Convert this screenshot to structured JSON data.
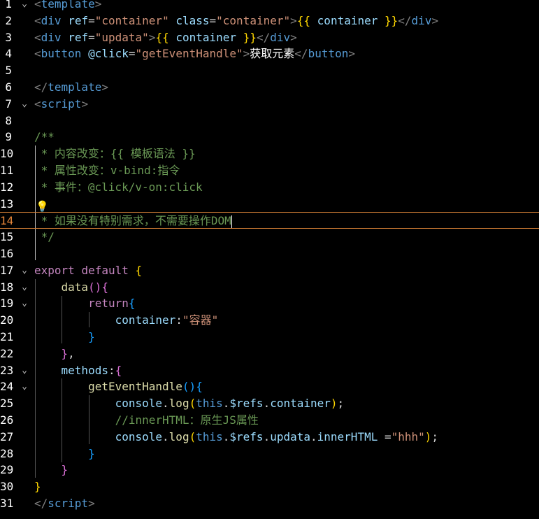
{
  "editor": {
    "current_line": 14,
    "lines": [
      {
        "n": "1",
        "fold": true,
        "tokens": [
          [
            "tag",
            "<"
          ],
          [
            "tn",
            "template"
          ],
          [
            "tag",
            ">"
          ]
        ]
      },
      {
        "n": "2",
        "fold": false,
        "tokens": [
          [
            "tag",
            "<"
          ],
          [
            "tn",
            "div"
          ],
          [
            "op",
            " "
          ],
          [
            "attr",
            "ref"
          ],
          [
            "op",
            "="
          ],
          [
            "str",
            "\"container\""
          ],
          [
            "op",
            " "
          ],
          [
            "attr",
            "class"
          ],
          [
            "op",
            "="
          ],
          [
            "str",
            "\"container\""
          ],
          [
            "tag",
            ">"
          ],
          [
            "br",
            "{{"
          ],
          [
            "op",
            " "
          ],
          [
            "var",
            "container"
          ],
          [
            "op",
            " "
          ],
          [
            "br",
            "}}"
          ],
          [
            "tag",
            "</"
          ],
          [
            "tn",
            "div"
          ],
          [
            "tag",
            ">"
          ]
        ]
      },
      {
        "n": "3",
        "fold": false,
        "tokens": [
          [
            "tag",
            "<"
          ],
          [
            "tn",
            "div"
          ],
          [
            "op",
            " "
          ],
          [
            "attr",
            "ref"
          ],
          [
            "op",
            "="
          ],
          [
            "str",
            "\"updata\""
          ],
          [
            "tag",
            ">"
          ],
          [
            "br",
            "{{"
          ],
          [
            "op",
            " "
          ],
          [
            "var",
            "container"
          ],
          [
            "op",
            " "
          ],
          [
            "br",
            "}}"
          ],
          [
            "tag",
            "</"
          ],
          [
            "tn",
            "div"
          ],
          [
            "tag",
            ">"
          ]
        ]
      },
      {
        "n": "4",
        "fold": false,
        "tokens": [
          [
            "tag",
            "<"
          ],
          [
            "tn",
            "button"
          ],
          [
            "op",
            " "
          ],
          [
            "attr",
            "@click"
          ],
          [
            "op",
            "="
          ],
          [
            "str",
            "\"getEventHandle\""
          ],
          [
            "tag",
            ">"
          ],
          [
            "txt",
            "获取元素"
          ],
          [
            "tag",
            "</"
          ],
          [
            "tn",
            "button"
          ],
          [
            "tag",
            ">"
          ]
        ]
      },
      {
        "n": "5",
        "fold": false,
        "tokens": []
      },
      {
        "n": "6",
        "fold": false,
        "tokens": [
          [
            "tag",
            "</"
          ],
          [
            "tn",
            "template"
          ],
          [
            "tag",
            ">"
          ]
        ]
      },
      {
        "n": "7",
        "fold": true,
        "tokens": [
          [
            "tag",
            "<"
          ],
          [
            "tn",
            "script"
          ],
          [
            "tag",
            ">"
          ]
        ]
      },
      {
        "n": "8",
        "fold": false,
        "tokens": []
      },
      {
        "n": "9",
        "fold": false,
        "tokens": [
          [
            "cm",
            "/**"
          ]
        ]
      },
      {
        "n": "10",
        "fold": false,
        "tokens": [
          [
            "cm",
            " * 内容改变：{{ 模板语法 }}"
          ]
        ]
      },
      {
        "n": "11",
        "fold": false,
        "tokens": [
          [
            "cm",
            " * 属性改变：v-bind:指令"
          ]
        ]
      },
      {
        "n": "12",
        "fold": false,
        "tokens": [
          [
            "cm",
            " * 事件：@click/v-on:click"
          ]
        ]
      },
      {
        "n": "13",
        "fold": false,
        "tokens": []
      },
      {
        "n": "14",
        "fold": false,
        "tokens": [
          [
            "cm",
            " * 如果没有特别需求，不需要操作DOM"
          ]
        ]
      },
      {
        "n": "15",
        "fold": false,
        "tokens": [
          [
            "cm",
            " */"
          ]
        ]
      },
      {
        "n": "16",
        "fold": false,
        "tokens": []
      },
      {
        "n": "17",
        "fold": true,
        "tokens": [
          [
            "kw",
            "export"
          ],
          [
            "op",
            " "
          ],
          [
            "kw",
            "default"
          ],
          [
            "op",
            " "
          ],
          [
            "br",
            "{"
          ]
        ]
      },
      {
        "n": "18",
        "fold": true,
        "tokens": [
          [
            "op",
            "    "
          ],
          [
            "fn",
            "data"
          ],
          [
            "br2",
            "()"
          ],
          [
            "br2",
            "{"
          ]
        ]
      },
      {
        "n": "19",
        "fold": true,
        "tokens": [
          [
            "op",
            "        "
          ],
          [
            "kw",
            "return"
          ],
          [
            "br3",
            "{"
          ]
        ]
      },
      {
        "n": "20",
        "fold": false,
        "tokens": [
          [
            "op",
            "            "
          ],
          [
            "var",
            "container"
          ],
          [
            "op",
            ":"
          ],
          [
            "str",
            "\"容器\""
          ]
        ]
      },
      {
        "n": "21",
        "fold": false,
        "tokens": [
          [
            "op",
            "        "
          ],
          [
            "br3",
            "}"
          ]
        ]
      },
      {
        "n": "22",
        "fold": false,
        "tokens": [
          [
            "op",
            "    "
          ],
          [
            "br2",
            "}"
          ],
          [
            "op",
            ","
          ]
        ]
      },
      {
        "n": "23",
        "fold": true,
        "tokens": [
          [
            "op",
            "    "
          ],
          [
            "var",
            "methods"
          ],
          [
            "op",
            ":"
          ],
          [
            "br2",
            "{"
          ]
        ]
      },
      {
        "n": "24",
        "fold": true,
        "tokens": [
          [
            "op",
            "        "
          ],
          [
            "fn",
            "getEventHandle"
          ],
          [
            "br3",
            "()"
          ],
          [
            "br3",
            "{"
          ]
        ]
      },
      {
        "n": "25",
        "fold": false,
        "tokens": [
          [
            "op",
            "            "
          ],
          [
            "var",
            "console"
          ],
          [
            "op",
            "."
          ],
          [
            "fn",
            "log"
          ],
          [
            "br",
            "("
          ],
          [
            "kw2",
            "this"
          ],
          [
            "op",
            "."
          ],
          [
            "var",
            "$refs"
          ],
          [
            "op",
            "."
          ],
          [
            "var",
            "container"
          ],
          [
            "br",
            ")"
          ],
          [
            "op",
            ";"
          ]
        ]
      },
      {
        "n": "26",
        "fold": false,
        "tokens": [
          [
            "op",
            "            "
          ],
          [
            "cm",
            "//innerHTML：原生JS属性"
          ]
        ]
      },
      {
        "n": "27",
        "fold": false,
        "tokens": [
          [
            "op",
            "            "
          ],
          [
            "var",
            "console"
          ],
          [
            "op",
            "."
          ],
          [
            "fn",
            "log"
          ],
          [
            "br",
            "("
          ],
          [
            "kw2",
            "this"
          ],
          [
            "op",
            "."
          ],
          [
            "var",
            "$refs"
          ],
          [
            "op",
            "."
          ],
          [
            "var",
            "updata"
          ],
          [
            "op",
            "."
          ],
          [
            "var",
            "innerHTML"
          ],
          [
            "op",
            " ="
          ],
          [
            "str",
            "\"hhh\""
          ],
          [
            "br",
            ")"
          ],
          [
            "op",
            ";"
          ]
        ]
      },
      {
        "n": "28",
        "fold": false,
        "tokens": [
          [
            "op",
            "        "
          ],
          [
            "br3",
            "}"
          ]
        ]
      },
      {
        "n": "29",
        "fold": false,
        "tokens": [
          [
            "op",
            "    "
          ],
          [
            "br2",
            "}"
          ]
        ]
      },
      {
        "n": "30",
        "fold": false,
        "tokens": [
          [
            "br",
            "}"
          ]
        ]
      },
      {
        "n": "31",
        "fold": false,
        "tokens": [
          [
            "tag",
            "</"
          ],
          [
            "tn",
            "script"
          ],
          [
            "tag",
            ">"
          ]
        ]
      }
    ]
  }
}
